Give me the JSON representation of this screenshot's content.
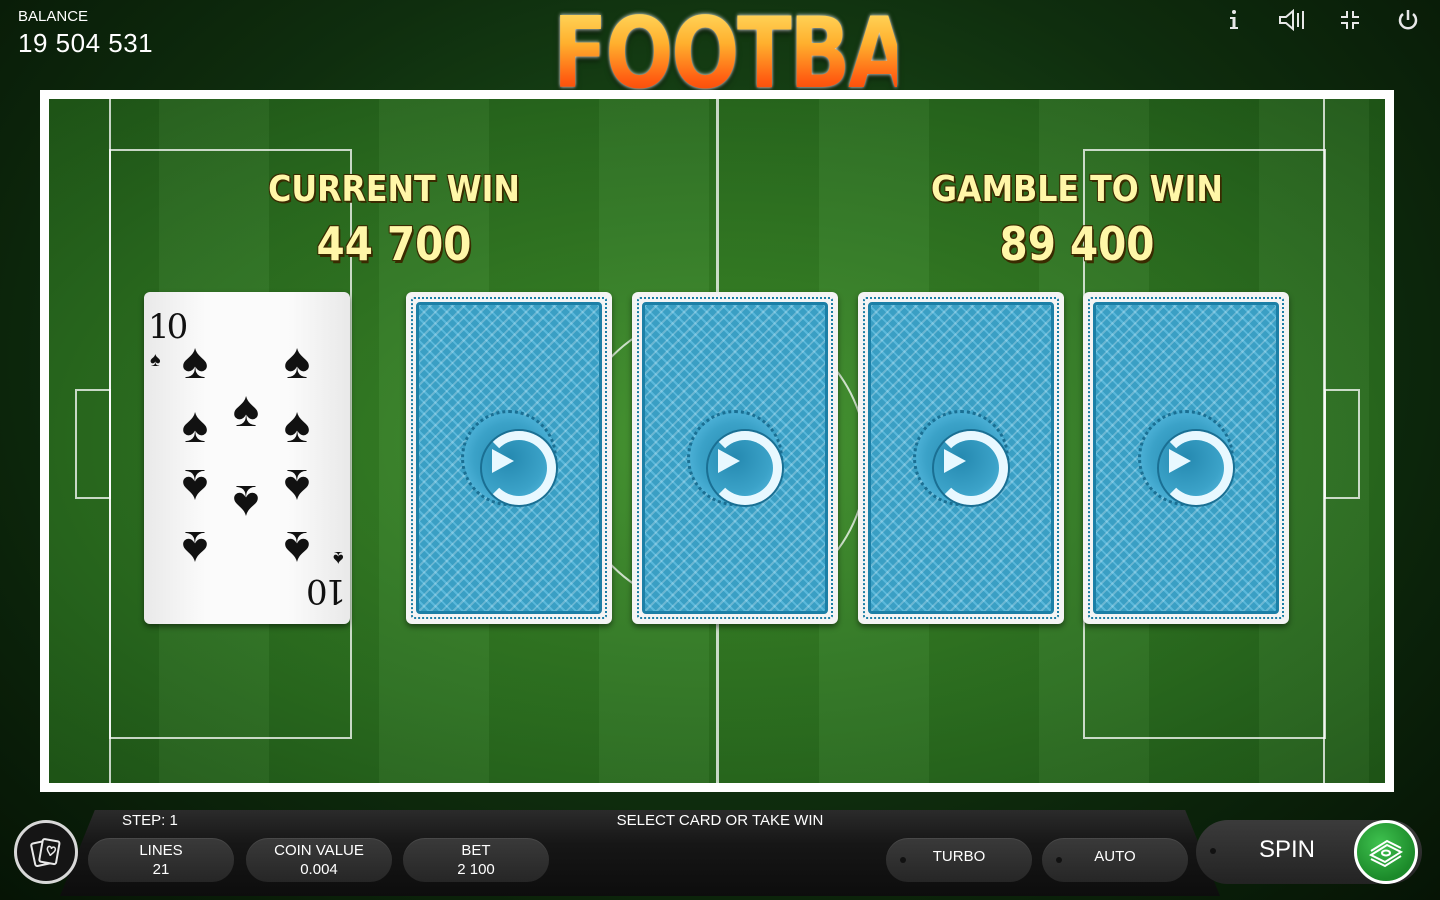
{
  "header": {
    "balance_label": "BALANCE",
    "balance_value": "19 504 531",
    "logo_text": "FOOTBALL",
    "icons": [
      "info-icon",
      "sound-icon",
      "fullscreen-icon",
      "power-icon"
    ]
  },
  "gamble": {
    "current_win_label": "CURRENT WIN",
    "current_win_value": "44 700",
    "gamble_to_win_label": "GAMBLE TO WIN",
    "gamble_to_win_value": "89 400",
    "dealer_card": {
      "rank": "10",
      "suit": "spades",
      "suit_symbol": "♠"
    },
    "face_down_cards": 4
  },
  "bottom": {
    "step_label": "STEP: 1",
    "instruction": "SELECT CARD OR TAKE WIN",
    "lines": {
      "label": "LINES",
      "value": "21"
    },
    "coin_value": {
      "label": "COIN VALUE",
      "value": "0.004"
    },
    "bet": {
      "label": "BET",
      "value": "2 100"
    },
    "turbo_label": "TURBO",
    "auto_label": "AUTO",
    "spin_label": "SPIN"
  },
  "colors": {
    "pitch_green": "#2c7020",
    "win_text": "#fff7a8",
    "card_back_blue": "#3a9fc4",
    "spin_green": "#1c8a2a"
  }
}
